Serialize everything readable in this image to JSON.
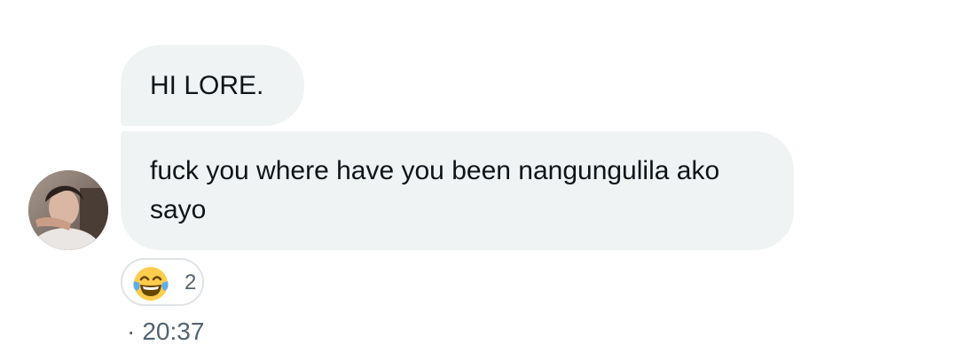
{
  "messages": [
    {
      "text": "HI LORE."
    },
    {
      "text": "fuck you where have you been nangungulila ako sayo"
    }
  ],
  "reaction": {
    "emoji": "laughing-with-tears",
    "count": "2"
  },
  "timestamp": {
    "separator": "·",
    "time": "20:37"
  },
  "colors": {
    "bubble_bg": "#eff3f4",
    "text": "#0f1419",
    "secondary_text": "#536471",
    "reaction_border": "#dfe3e6"
  }
}
